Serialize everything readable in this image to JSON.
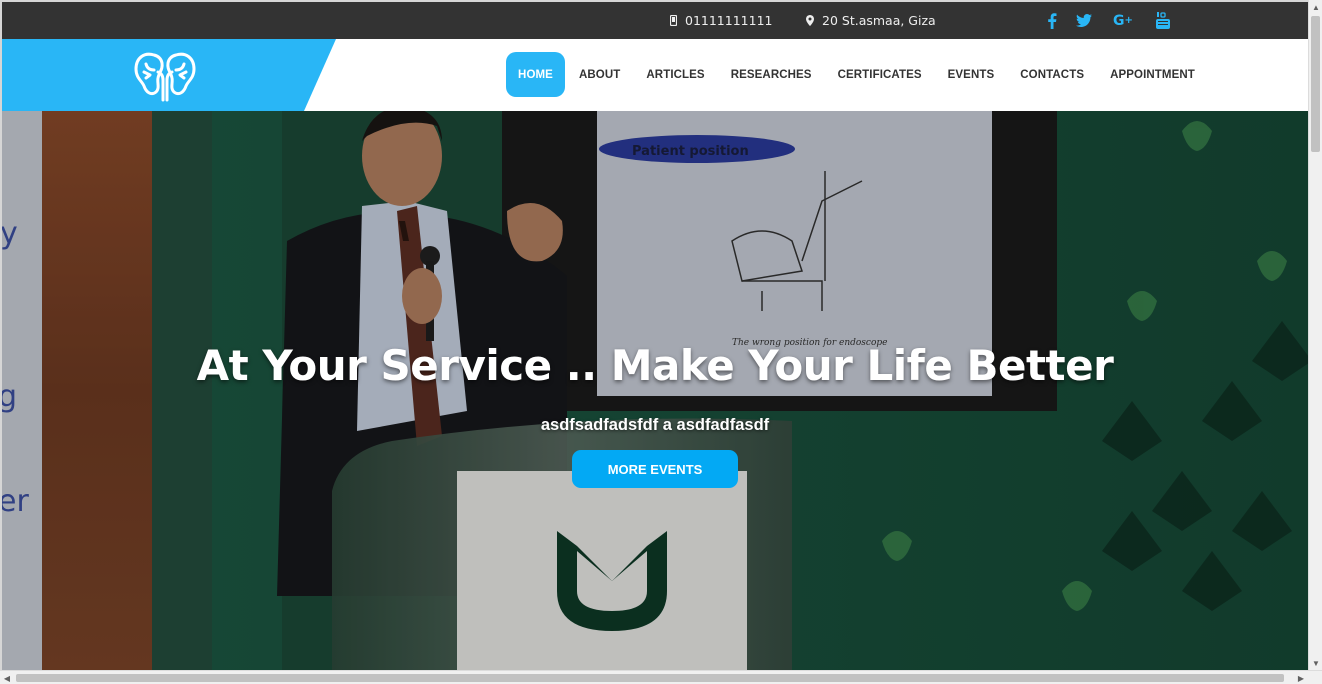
{
  "topbar": {
    "phone": "01111111111",
    "address": "20 St.asmaa, Giza",
    "phone_icon": "mobile-phone-icon",
    "address_icon": "map-marker-icon",
    "social": [
      {
        "name": "facebook-icon",
        "glyph": "f"
      },
      {
        "name": "twitter-icon",
        "glyph": "t"
      },
      {
        "name": "google-plus-icon",
        "glyph": "G+"
      },
      {
        "name": "youtube-icon",
        "glyph": "You"
      }
    ],
    "accent": "#29b6f6",
    "background": "#333333"
  },
  "nav": {
    "logo_icon": "kidneys-logo-icon",
    "items": [
      {
        "label": "HOME",
        "active": true
      },
      {
        "label": "ABOUT"
      },
      {
        "label": "ARTICLES"
      },
      {
        "label": "RESEARCHES"
      },
      {
        "label": "CERTIFICATES"
      },
      {
        "label": "EVENTS"
      },
      {
        "label": "CONTACTS"
      },
      {
        "label": "APPOINTMENT"
      }
    ],
    "accent": "#29b6f6"
  },
  "hero": {
    "title": "At Your Service .. Make Your Life Better",
    "subtitle": "asdfsadfadsfdf a asdfadfasdf",
    "button_label": "MORE EVENTS",
    "button_color": "#03a9f4",
    "slide_text": "Patient position"
  }
}
